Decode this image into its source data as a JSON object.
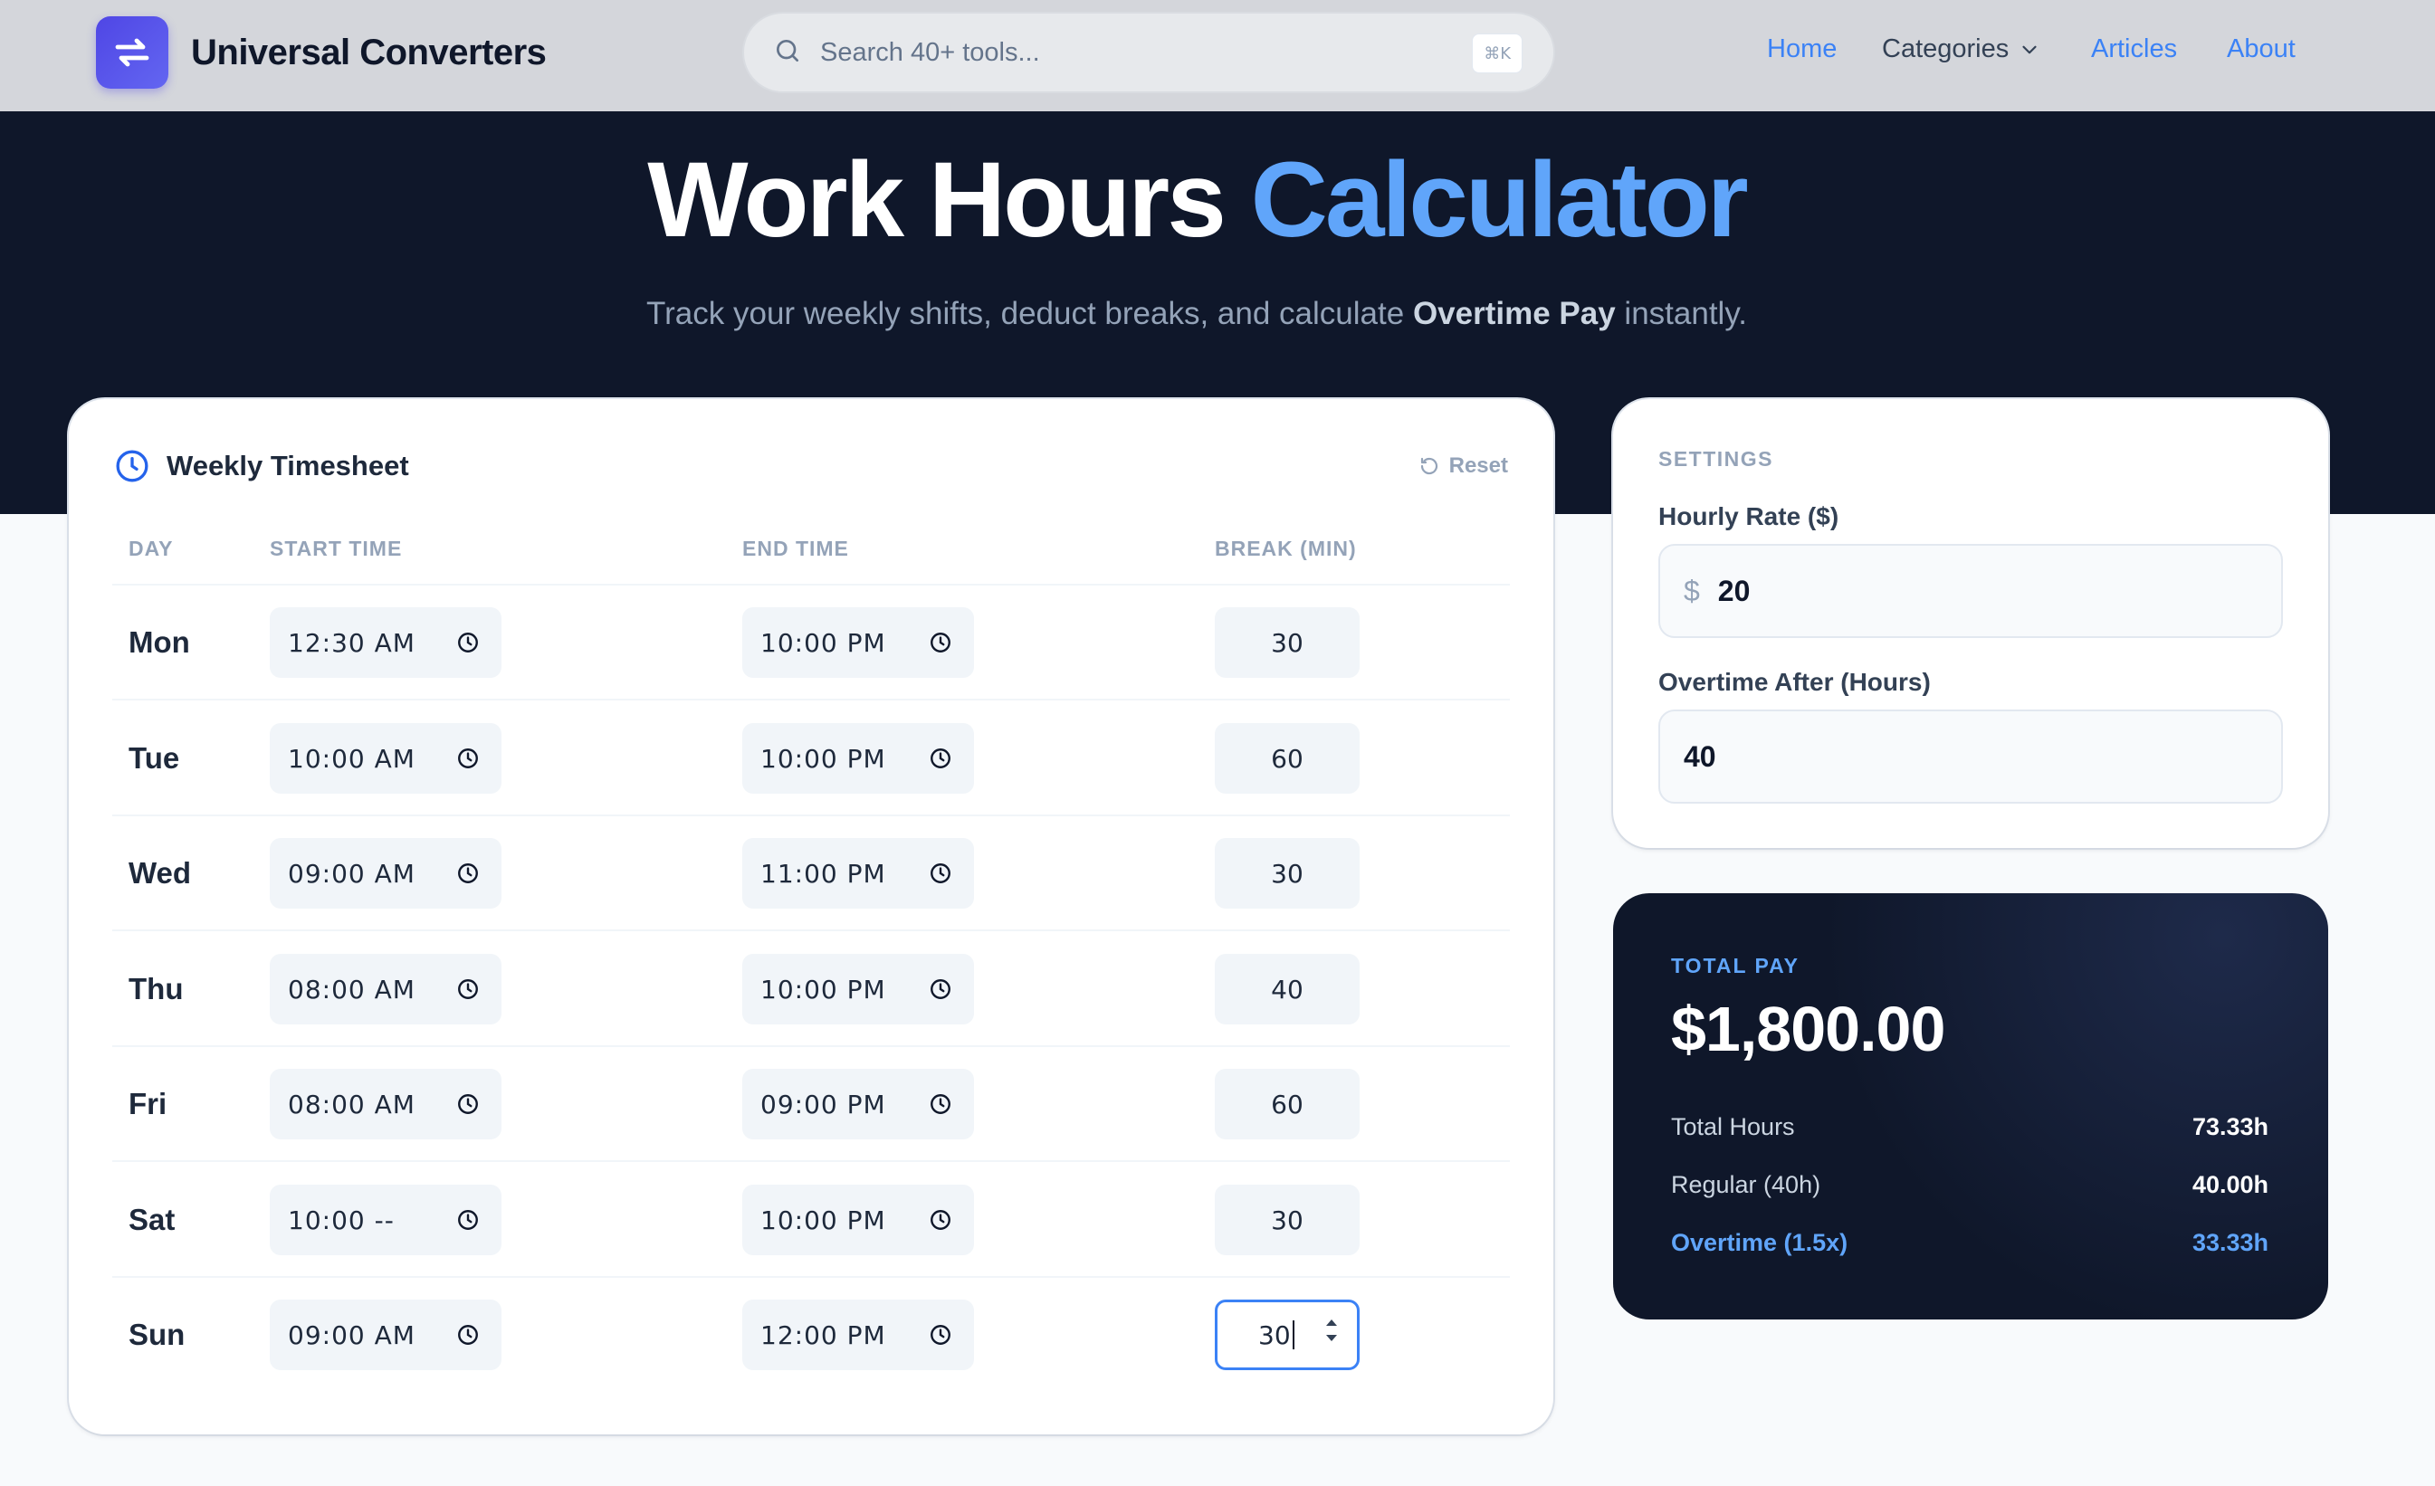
{
  "header": {
    "brand": "Universal Converters",
    "search_placeholder": "Search 40+ tools...",
    "shortcut": "⌘K",
    "nav": {
      "home": "Home",
      "categories": "Categories",
      "articles": "Articles",
      "about": "About"
    }
  },
  "hero": {
    "title_main": "Work Hours",
    "title_accent": "Calculator",
    "subtitle_pre": "Track your weekly shifts, deduct breaks, and calculate",
    "subtitle_bold": "Overtime Pay",
    "subtitle_post": "instantly."
  },
  "timesheet": {
    "title": "Weekly Timesheet",
    "reset_label": "Reset",
    "columns": [
      "DAY",
      "START TIME",
      "END TIME",
      "BREAK (MIN)"
    ],
    "rows": [
      {
        "day": "Mon",
        "start": "12:30 AM",
        "end": "10:00 PM",
        "break": "30"
      },
      {
        "day": "Tue",
        "start": "10:00 AM",
        "end": "10:00 PM",
        "break": "60"
      },
      {
        "day": "Wed",
        "start": "09:00 AM",
        "end": "11:00 PM",
        "break": "30"
      },
      {
        "day": "Thu",
        "start": "08:00 AM",
        "end": "10:00 PM",
        "break": "40"
      },
      {
        "day": "Fri",
        "start": "08:00 AM",
        "end": "09:00 PM",
        "break": "60"
      },
      {
        "day": "Sat",
        "start": "10:00 --",
        "end": "10:00 PM",
        "break": "30"
      },
      {
        "day": "Sun",
        "start": "09:00 AM",
        "end": "12:00 PM",
        "break": "30"
      }
    ]
  },
  "settings": {
    "section_label": "SETTINGS",
    "hourly_rate_label": "Hourly Rate ($)",
    "currency_symbol": "$",
    "hourly_rate": "20",
    "overtime_label": "Overtime After (Hours)",
    "overtime_after": "40"
  },
  "result": {
    "label": "TOTAL PAY",
    "total_pay": "$1,800.00",
    "total_hours_label": "Total Hours",
    "total_hours": "73.33h",
    "regular_label": "Regular (40h)",
    "regular": "40.00h",
    "overtime_label": "Overtime (1.5x)",
    "overtime": "33.33h"
  },
  "colors": {
    "accent": "#3b82f6",
    "accent_light": "#60a5fa",
    "hero_bg": "#0f172a",
    "brand": "#4f46e5"
  },
  "icons": [
    "refresh-icon",
    "search-icon",
    "chevron-down-icon",
    "clock-icon",
    "reset-icon",
    "time-icon"
  ]
}
